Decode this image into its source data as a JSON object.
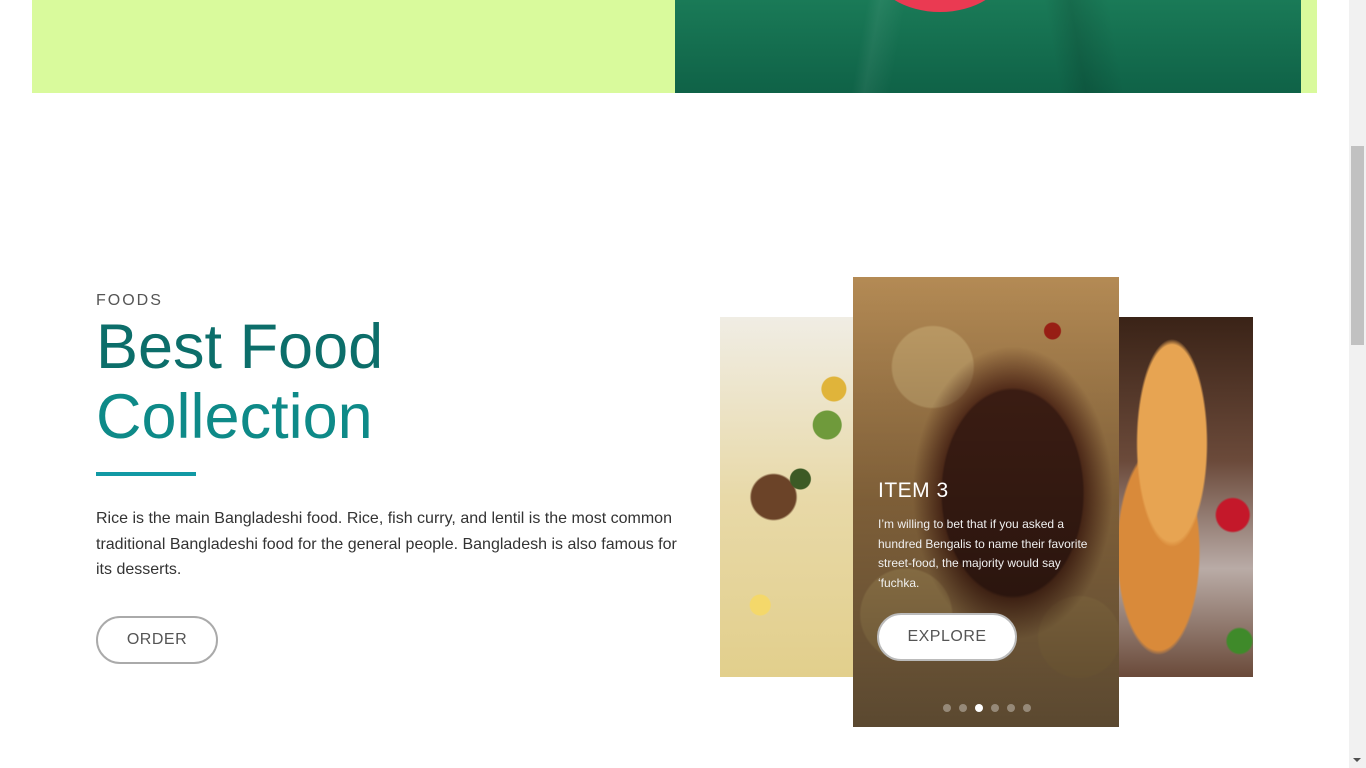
{
  "section": {
    "eyebrow": "FOODS",
    "headline_line1": "Best Food",
    "headline_line2": "Collection",
    "body": "Rice is the main Bangladeshi food. Rice, fish curry, and lentil is the most common traditional Bangladeshi food for the general people. Bangladesh is also famous for its desserts.",
    "order_label": "ORDER"
  },
  "carousel": {
    "active_slide": {
      "title": "ITEM 3",
      "description": "I’m willing to bet that if you asked a hundred Bengalis to name their favorite street-food, the majority would say ‘fuchka.",
      "button_label": "EXPLORE"
    },
    "dot_count": 6,
    "active_dot_index": 2
  },
  "colors": {
    "hero_band": "#d9fa9c",
    "accent_teal": "#0e8a88",
    "divider": "#1199a4"
  }
}
